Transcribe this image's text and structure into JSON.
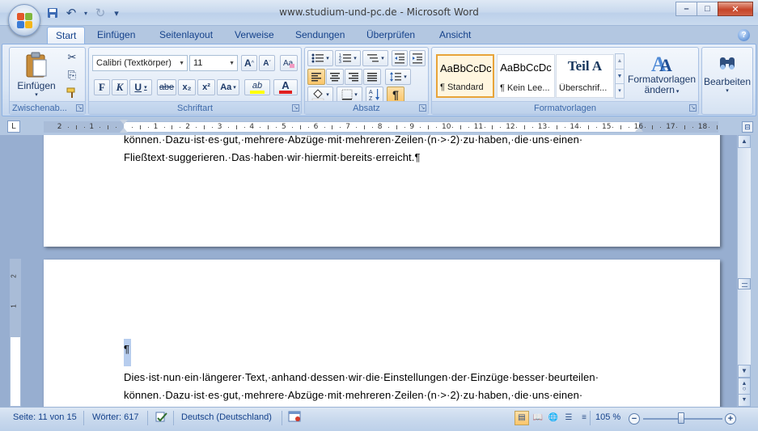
{
  "window": {
    "title": "www.studium-und-pc.de - Microsoft Word",
    "min_glyph": "–",
    "max_glyph": "□",
    "close_glyph": "✕"
  },
  "qat": {
    "save_glyph": "💾",
    "undo_glyph": "↶",
    "redo_glyph": "↻",
    "customize_glyph": "▾"
  },
  "tabs": [
    "Start",
    "Einfügen",
    "Seitenlayout",
    "Verweise",
    "Sendungen",
    "Überprüfen",
    "Ansicht"
  ],
  "help_glyph": "?",
  "ribbon": {
    "clipboard": {
      "label": "Zwischenab...",
      "paste_label": "Einfügen",
      "cut_glyph": "✂",
      "copy_glyph": "⎘",
      "painter_glyph": "🖌"
    },
    "font": {
      "label": "Schriftart",
      "font_name": "Calibri (Textkörper)",
      "font_size": "11",
      "grow_glyph": "A^",
      "shrink_glyph": "Aˇ",
      "clear_glyph": "A✎",
      "bold": "F",
      "italic": "K",
      "underline": "U",
      "strike": "abe",
      "subscript": "x₂",
      "superscript": "x²",
      "case": "Aa",
      "highlight": "ab",
      "font_color": "A"
    },
    "paragraph": {
      "label": "Absatz",
      "bullets_glyph": "☰",
      "numbering_glyph": "1≡",
      "multilevel_glyph": "≣",
      "outdent_glyph": "⇤",
      "indent_glyph": "⇥",
      "align_left_glyph": "≡",
      "center_glyph": "≡",
      "align_right_glyph": "≡",
      "justify_glyph": "≡",
      "spacing_glyph": "↕",
      "shading_glyph": "◇",
      "borders_glyph": "⊞",
      "sort_glyph": "A↓Z",
      "pilcrow_glyph": "¶"
    },
    "styles": {
      "label": "Formatvorlagen",
      "items": [
        {
          "preview": "AaBbCcDc",
          "name": "¶ Standard"
        },
        {
          "preview": "AaBbCcDc",
          "name": "¶ Kein Lee..."
        },
        {
          "preview": "Teil A",
          "name": "Überschrif..."
        }
      ],
      "change_label_1": "Formatvorlagen",
      "change_label_2": "ändern",
      "change_glyph": "A"
    },
    "editing": {
      "label": "Bearbeiten",
      "glyph": "🔭"
    }
  },
  "ruler": {
    "corner_glyph": "L",
    "numbers": [
      "2",
      "1",
      "1",
      "2",
      "3",
      "4",
      "5",
      "6",
      "7",
      "8",
      "9",
      "10",
      "11",
      "12",
      "13",
      "14",
      "15",
      "16",
      "17",
      "18"
    ],
    "vertical_numbers": [
      "2",
      "1"
    ],
    "view_ruler_glyph": "⊟"
  },
  "document": {
    "page1_line1": "können.·Dazu·ist·es·gut,·mehrere·Abzüge·mit·mehreren·Zeilen·(n·>·2)·zu·haben,·die·uns·einen·",
    "page1_line2": "Fließtext·suggerieren.·Das·haben·wir·hiermit·bereits·erreicht.¶",
    "page1_top_partial": "können.·Dazu·ist·es·gut,·mehrere·Abzüge·mit·mehreren·Zeilen·(n·>·2)·zu·haben,·die·uns·einen·",
    "page2_pilcrow": "¶",
    "page2_line1": "Dies·ist·nun·ein·längerer·Text,·anhand·dessen·wir·die·Einstellungen·der·Einzüge·besser·beurteilen·",
    "page2_line2": "können.·Dazu·ist·es·gut,·mehrere·Abzüge·mit·mehreren·Zeilen·(n·>·2)·zu·haben,·die·uns·einen·"
  },
  "scrollbar": {
    "up_glyph": "▲",
    "down_glyph": "▼",
    "prev_glyph": "▲",
    "select_glyph": "○",
    "next_glyph": "▼"
  },
  "status": {
    "page": "Seite: 11 von 15",
    "words": "Wörter: 617",
    "language": "Deutsch (Deutschland)",
    "zoom": "105 %",
    "zoom_minus": "−",
    "zoom_plus": "+"
  },
  "colors": {
    "accent": "#15428b",
    "ribbon_blue": "#c6d7ee",
    "selection": "#b7cdee",
    "active_button": "#fbc66a"
  }
}
